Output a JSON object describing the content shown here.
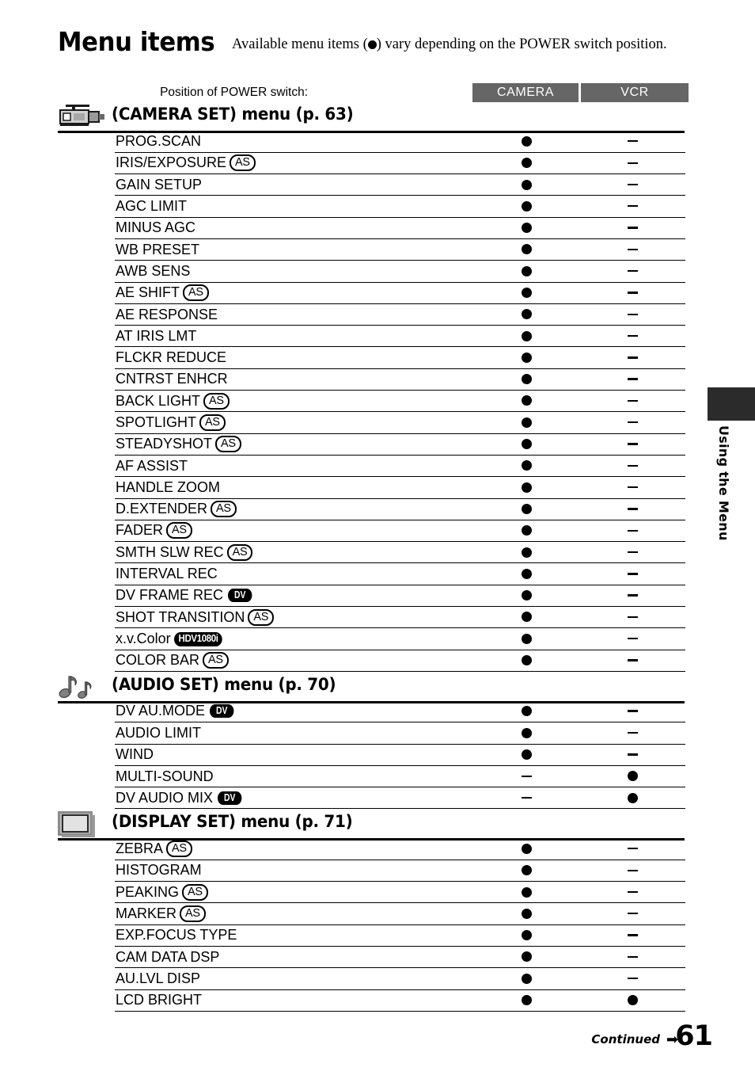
{
  "page": {
    "title": "Menu items",
    "intro_before": "Available menu items (",
    "intro_after": ") vary depending on the POWER switch position.",
    "number": "61",
    "continued_label": "Continued",
    "continued_arrow": "➡",
    "side_tab_label": "Using the Menu"
  },
  "switch_header": {
    "label": "Position of POWER switch:",
    "columns": [
      "CAMERA",
      "VCR"
    ]
  },
  "marks": {
    "available": "●",
    "unavailable": "–"
  },
  "sections": [
    {
      "icon": "camcorder-icon",
      "title": "(CAMERA SET) menu (p. 63)",
      "rows": [
        {
          "label": "PROG.SCAN",
          "badge": "",
          "camera": "dot",
          "vcr": "dash"
        },
        {
          "label": "IRIS/EXPOSURE",
          "badge": "AS",
          "camera": "dot",
          "vcr": "dash"
        },
        {
          "label": "GAIN SETUP",
          "badge": "",
          "camera": "dot",
          "vcr": "dash"
        },
        {
          "label": "AGC LIMIT",
          "badge": "",
          "camera": "dot",
          "vcr": "dash"
        },
        {
          "label": "MINUS AGC",
          "badge": "",
          "camera": "dot",
          "vcr": "dash"
        },
        {
          "label": "WB PRESET",
          "badge": "",
          "camera": "dot",
          "vcr": "dash"
        },
        {
          "label": "AWB SENS",
          "badge": "",
          "camera": "dot",
          "vcr": "dash"
        },
        {
          "label": "AE SHIFT",
          "badge": "AS",
          "camera": "dot",
          "vcr": "dash"
        },
        {
          "label": "AE  RESPONSE",
          "badge": "",
          "camera": "dot",
          "vcr": "dash"
        },
        {
          "label": "AT IRIS LMT",
          "badge": "",
          "camera": "dot",
          "vcr": "dash"
        },
        {
          "label": "FLCKR  REDUCE",
          "badge": "",
          "camera": "dot",
          "vcr": "dash"
        },
        {
          "label": "CNTRST ENHCR",
          "badge": "",
          "camera": "dot",
          "vcr": "dash"
        },
        {
          "label": "BACK LIGHT",
          "badge": "AS",
          "camera": "dot",
          "vcr": "dash"
        },
        {
          "label": "SPOTLIGHT",
          "badge": "AS",
          "camera": "dot",
          "vcr": "dash"
        },
        {
          "label": "STEADYSHOT",
          "badge": "AS",
          "camera": "dot",
          "vcr": "dash"
        },
        {
          "label": "AF ASSIST",
          "badge": "",
          "camera": "dot",
          "vcr": "dash"
        },
        {
          "label": "HANDLE ZOOM",
          "badge": "",
          "camera": "dot",
          "vcr": "dash"
        },
        {
          "label": "D.EXTENDER",
          "badge": "AS",
          "camera": "dot",
          "vcr": "dash"
        },
        {
          "label": "FADER",
          "badge": "AS",
          "camera": "dot",
          "vcr": "dash"
        },
        {
          "label": "SMTH SLW REC",
          "badge": "AS",
          "camera": "dot",
          "vcr": "dash"
        },
        {
          "label": "INTERVAL REC",
          "badge": "",
          "camera": "dot",
          "vcr": "dash"
        },
        {
          "label": "DV FRAME REC",
          "badge": "DV",
          "camera": "dot",
          "vcr": "dash"
        },
        {
          "label": "SHOT TRANSITION",
          "badge": "AS",
          "camera": "dot",
          "vcr": "dash"
        },
        {
          "label": "x.v.Color",
          "badge": "HDV1080i",
          "camera": "dot",
          "vcr": "dash"
        },
        {
          "label": "COLOR BAR",
          "badge": "AS",
          "camera": "dot",
          "vcr": "dash"
        }
      ]
    },
    {
      "icon": "music-notes-icon",
      "title": "(AUDIO SET) menu (p. 70)",
      "rows": [
        {
          "label": "DV AU.MODE",
          "badge": "DV",
          "camera": "dot",
          "vcr": "dash"
        },
        {
          "label": "AUDIO LIMIT",
          "badge": "",
          "camera": "dot",
          "vcr": "dash"
        },
        {
          "label": "WIND",
          "badge": "",
          "camera": "dot",
          "vcr": "dash"
        },
        {
          "label": "MULTI-SOUND",
          "badge": "",
          "camera": "dash",
          "vcr": "dot"
        },
        {
          "label": "DV AUDIO MIX",
          "badge": "DV",
          "camera": "dash",
          "vcr": "dot"
        }
      ]
    },
    {
      "icon": "screen-icon",
      "title": "(DISPLAY SET) menu (p. 71)",
      "rows": [
        {
          "label": "ZEBRA",
          "badge": "AS",
          "camera": "dot",
          "vcr": "dash"
        },
        {
          "label": "HISTOGRAM",
          "badge": "",
          "camera": "dot",
          "vcr": "dash"
        },
        {
          "label": "PEAKING",
          "badge": "AS",
          "camera": "dot",
          "vcr": "dash"
        },
        {
          "label": "MARKER",
          "badge": "AS",
          "camera": "dot",
          "vcr": "dash"
        },
        {
          "label": "EXP.FOCUS TYPE",
          "badge": "",
          "camera": "dot",
          "vcr": "dash"
        },
        {
          "label": "CAM DATA DSP",
          "badge": "",
          "camera": "dot",
          "vcr": "dash"
        },
        {
          "label": "AU.LVL DISP",
          "badge": "",
          "camera": "dot",
          "vcr": "dash"
        },
        {
          "label": "LCD BRIGHT",
          "badge": "",
          "camera": "dot",
          "vcr": "dot"
        }
      ]
    }
  ]
}
